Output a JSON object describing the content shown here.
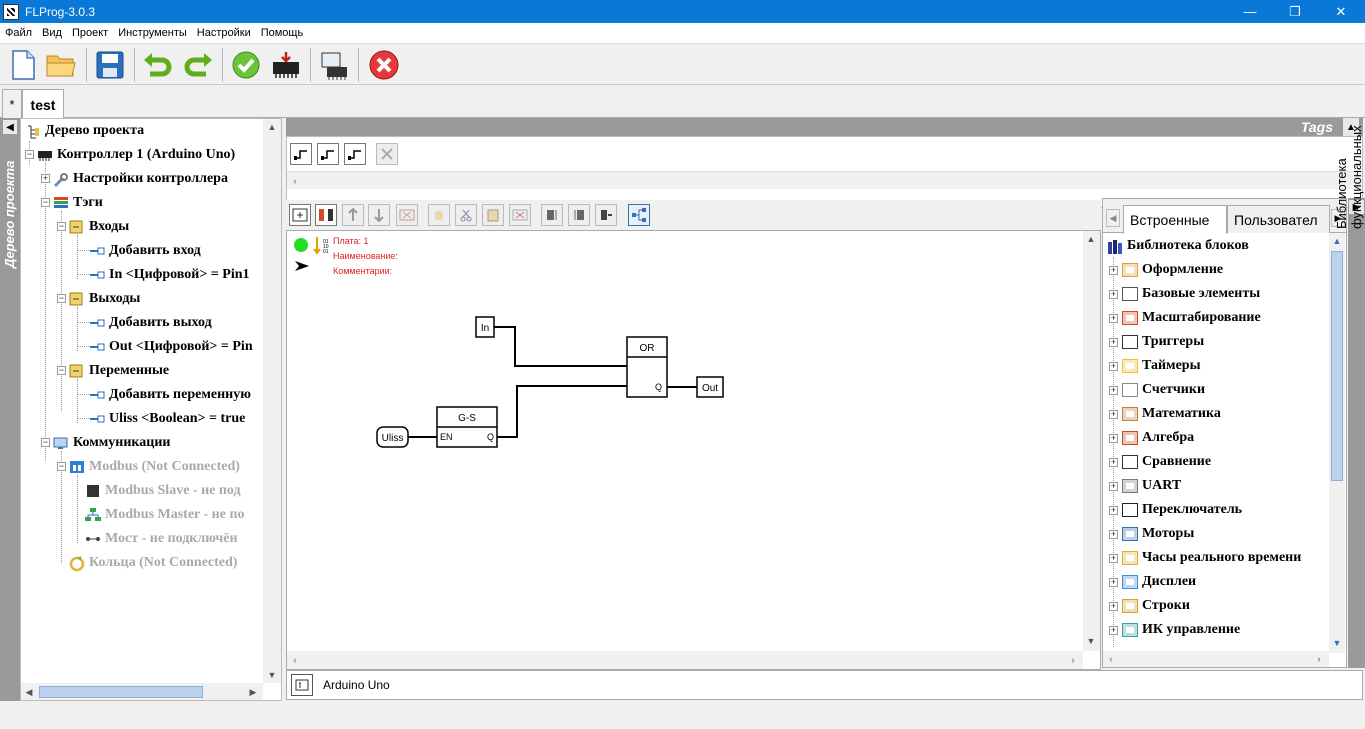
{
  "window": {
    "title": "FLProg-3.0.3",
    "controls": [
      "—",
      "❐",
      "✕"
    ]
  },
  "menu": [
    "Файл",
    "Вид",
    "Проект",
    "Инструменты",
    "Настройки",
    "Помощь"
  ],
  "toolbar": {
    "buttons": [
      "new-file",
      "open-folder",
      "save",
      "undo",
      "redo",
      "check",
      "upload",
      "controller",
      "stop"
    ]
  },
  "tabs": [
    {
      "label": "*"
    },
    {
      "label": "test"
    }
  ],
  "left_strip_label": "Дерево проекта",
  "tree": [
    {
      "label": "Дерево проекта",
      "state": "normal"
    },
    {
      "label": "Контроллер 1 (Arduino Uno)",
      "state": "normal"
    },
    {
      "label": "Настройки контроллера",
      "state": "normal"
    },
    {
      "label": "Тэги",
      "state": "normal"
    },
    {
      "label": "Входы",
      "state": "normal"
    },
    {
      "label": "Добавить вход",
      "state": "normal"
    },
    {
      "label": "In <Цифровой>  = Pin1",
      "state": "normal"
    },
    {
      "label": "Выходы",
      "state": "normal"
    },
    {
      "label": "Добавить выход",
      "state": "normal"
    },
    {
      "label": "Out <Цифровой>  = Pin",
      "state": "normal"
    },
    {
      "label": "Переменные",
      "state": "normal"
    },
    {
      "label": "Добавить переменную",
      "state": "normal"
    },
    {
      "label": "Uliss <Boolean>  = true",
      "state": "normal"
    },
    {
      "label": "Коммуникации",
      "state": "normal"
    },
    {
      "label": "Modbus (Not Connected)",
      "state": "disabled"
    },
    {
      "label": "Modbus Slave  - не под",
      "state": "disabled"
    },
    {
      "label": "Modbus Master  - не по",
      "state": "disabled"
    },
    {
      "label": "Мост - не подключён",
      "state": "disabled"
    },
    {
      "label": "Кольца (Not Connected)",
      "state": "disabled"
    }
  ],
  "tags_panel": {
    "label": "Tags"
  },
  "board_info": {
    "board": "Плата: 1",
    "name": "Наименование:",
    "comment": "Комментарии:",
    "bits": "01\n10\n01"
  },
  "diagram": {
    "blocks": {
      "in": "In",
      "or": "OR",
      "or_q": "Q",
      "out": "Out",
      "gs": "G-S",
      "gs_en": "EN",
      "gs_q": "Q",
      "uliss": "Uliss"
    }
  },
  "status": {
    "controller": "Arduino Uno"
  },
  "library": {
    "tabs": [
      "Встроенные",
      "Пользовател"
    ],
    "title": "Библиотека блоков",
    "items": [
      "Оформление",
      "Базовые элементы",
      "Масштабирование",
      "Триггеры",
      "Таймеры",
      "Счетчики",
      "Математика",
      "Алгебра",
      "Сравнение",
      "UART",
      "Переключатель",
      "Моторы",
      "Часы реального времени",
      "Дисплеи",
      "Строки",
      "ИК управление"
    ],
    "strip_label": "Библиотека функциональных блоков"
  },
  "colors": {
    "titlebar": "#0a78d7",
    "strip": "#9a9a9a",
    "info_red": "#e02020",
    "status_green": "#22dd22"
  }
}
